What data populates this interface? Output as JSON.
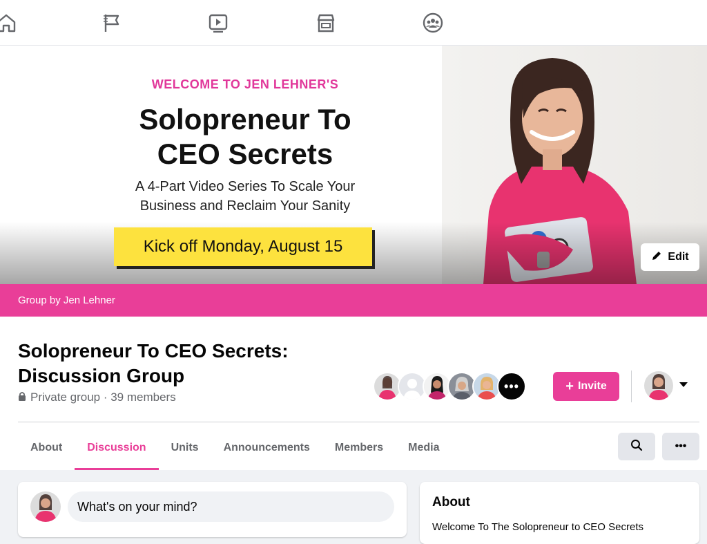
{
  "nav": {
    "icons": [
      "home-icon",
      "pages-flag-icon",
      "watch-video-icon",
      "marketplace-icon",
      "groups-icon"
    ]
  },
  "cover": {
    "welcome": "WELCOME TO JEN LEHNER'S",
    "title_line1": "Solopreneur To",
    "title_line2": "CEO Secrets",
    "subtitle_line1": "A 4-Part Video Series To Scale Your",
    "subtitle_line2": "Business and Reclaim Your Sanity",
    "banner": "Kick off Monday, August 15",
    "edit_label": "Edit",
    "colors": {
      "accent": "#e93e98",
      "banner": "#fde23e",
      "welcome": "#e1379a"
    }
  },
  "group": {
    "by_label": "Group by Jen Lehner",
    "title_line1": "Solopreneur To CEO Secrets:",
    "title_line2": "Discussion Group",
    "meta": "Private group · 39 members",
    "invite_label": "Invite",
    "more_members": "•••"
  },
  "tabs": [
    {
      "label": "About",
      "active": false
    },
    {
      "label": "Discussion",
      "active": true
    },
    {
      "label": "Units",
      "active": false
    },
    {
      "label": "Announcements",
      "active": false
    },
    {
      "label": "Members",
      "active": false
    },
    {
      "label": "Media",
      "active": false
    }
  ],
  "toolbar": {
    "more_label": "•••"
  },
  "composer": {
    "placeholder": "What's on your mind?"
  },
  "about": {
    "title": "About",
    "text": "Welcome To The Solopreneur to CEO Secrets"
  }
}
